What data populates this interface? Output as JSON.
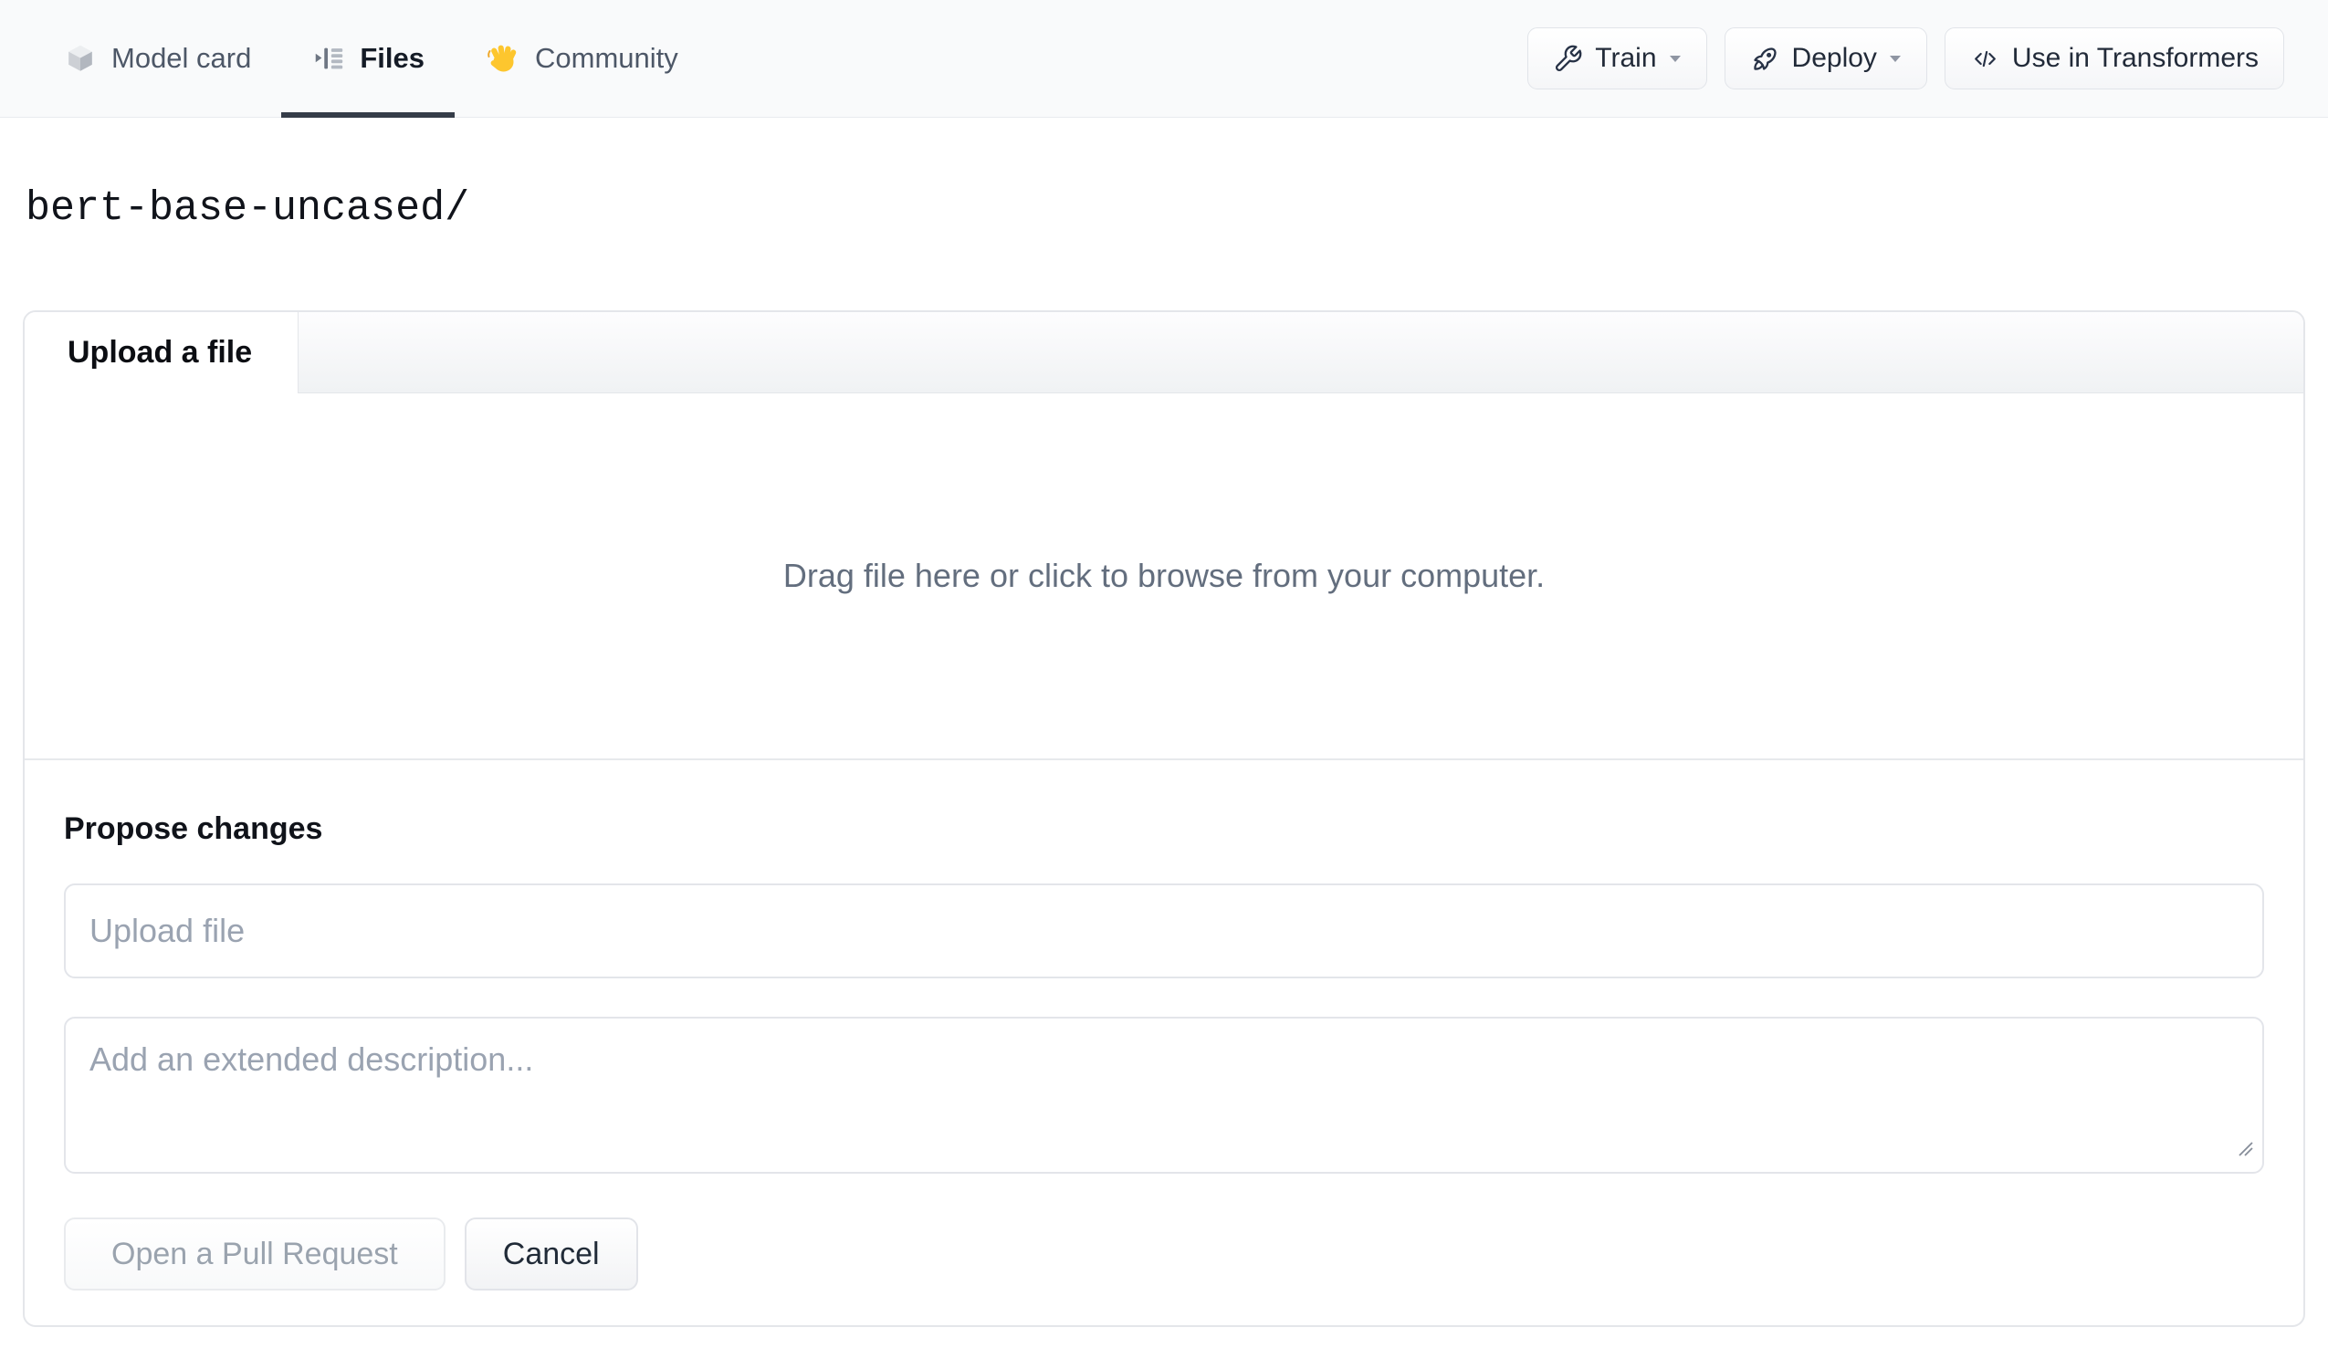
{
  "nav": {
    "tabs": [
      {
        "label": "Model card",
        "icon": "cube-icon",
        "active": false
      },
      {
        "label": "Files",
        "icon": "files-list-icon",
        "active": true
      },
      {
        "label": "Community",
        "icon": "waving-hand-icon",
        "active": false
      }
    ],
    "actions": [
      {
        "label": "Train",
        "icon": "wrench-icon",
        "caret": true
      },
      {
        "label": "Deploy",
        "icon": "rocket-icon",
        "caret": true
      },
      {
        "label": "Use in Transformers",
        "icon": "code-icon",
        "caret": false
      }
    ]
  },
  "breadcrumb": {
    "path": "bert-base-uncased/"
  },
  "upload_card": {
    "tab_label": "Upload a file",
    "dropzone_text": "Drag file here or click to browse from your computer.",
    "propose": {
      "heading": "Propose changes",
      "filename_placeholder": "Upload file",
      "description_placeholder": "Add an extended description...",
      "primary_button": "Open a Pull Request",
      "secondary_button": "Cancel"
    }
  },
  "colors": {
    "nav_background": "#f9fafb",
    "active_tab_underline": "#353c48",
    "border": "#e4e6ea",
    "muted_text": "#9aa3b1",
    "body_text": "#10131a",
    "secondary_text": "#4d5767",
    "hand_emoji_yellow": "#fdc62e"
  }
}
